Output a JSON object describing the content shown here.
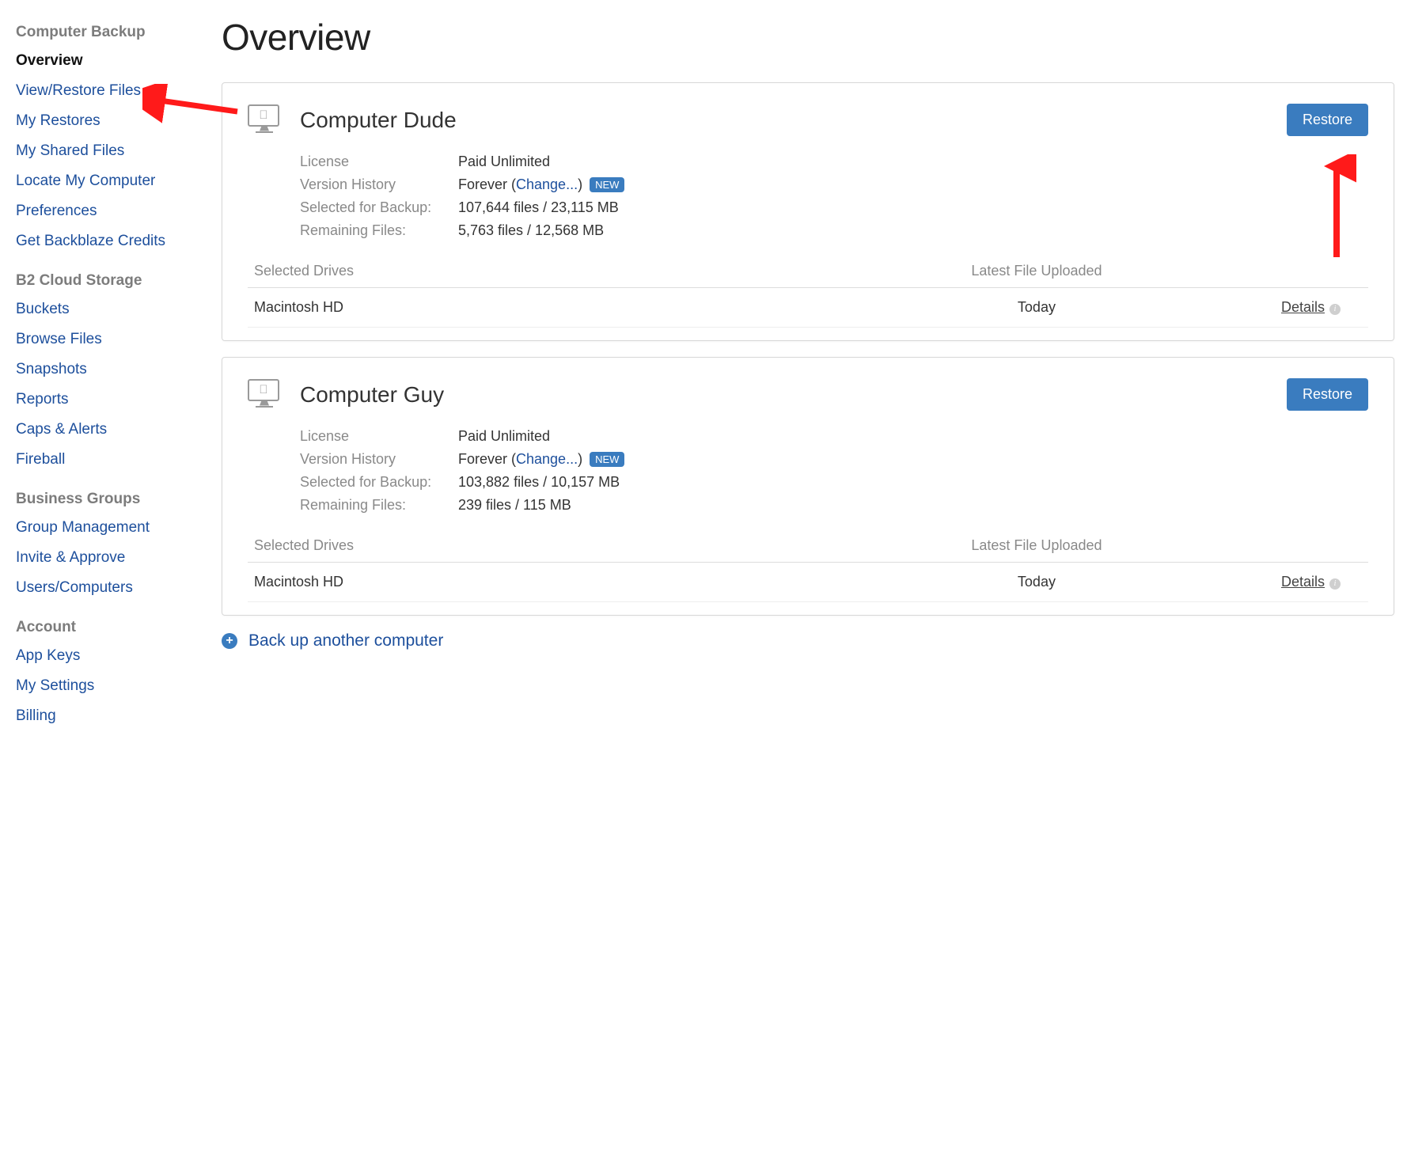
{
  "page": {
    "title": "Overview"
  },
  "sidebar": {
    "sections": [
      {
        "title": "Computer Backup",
        "items": [
          {
            "label": "Overview",
            "active": true
          },
          {
            "label": "View/Restore Files"
          },
          {
            "label": "My Restores"
          },
          {
            "label": "My Shared Files"
          },
          {
            "label": "Locate My Computer"
          },
          {
            "label": "Preferences"
          },
          {
            "label": "Get Backblaze Credits"
          }
        ]
      },
      {
        "title": "B2 Cloud Storage",
        "items": [
          {
            "label": "Buckets"
          },
          {
            "label": "Browse Files"
          },
          {
            "label": "Snapshots"
          },
          {
            "label": "Reports"
          },
          {
            "label": "Caps & Alerts"
          },
          {
            "label": "Fireball"
          }
        ]
      },
      {
        "title": "Business Groups",
        "items": [
          {
            "label": "Group Management"
          },
          {
            "label": "Invite & Approve"
          },
          {
            "label": "Users/Computers"
          }
        ]
      },
      {
        "title": "Account",
        "items": [
          {
            "label": "App Keys"
          },
          {
            "label": "My Settings"
          },
          {
            "label": "Billing"
          }
        ]
      }
    ]
  },
  "labels": {
    "license": "License",
    "version_history": "Version History",
    "selected_for_backup": "Selected for Backup:",
    "remaining_files": "Remaining Files:",
    "selected_drives": "Selected Drives",
    "latest_upload": "Latest File Uploaded",
    "details": "Details",
    "change": "Change...",
    "new": "NEW",
    "restore": "Restore",
    "backup_another": "Back up another computer"
  },
  "computers": [
    {
      "name": "Computer Dude",
      "license": "Paid Unlimited",
      "version_history": "Forever",
      "selected": "107,644 files / 23,115 MB",
      "remaining": "5,763 files / 12,568 MB",
      "drives": [
        {
          "name": "Macintosh HD",
          "uploaded": "Today"
        }
      ]
    },
    {
      "name": "Computer Guy",
      "license": "Paid Unlimited",
      "version_history": "Forever",
      "selected": "103,882 files / 10,157 MB",
      "remaining": "239 files / 115 MB",
      "drives": [
        {
          "name": "Macintosh HD",
          "uploaded": "Today"
        }
      ]
    }
  ]
}
